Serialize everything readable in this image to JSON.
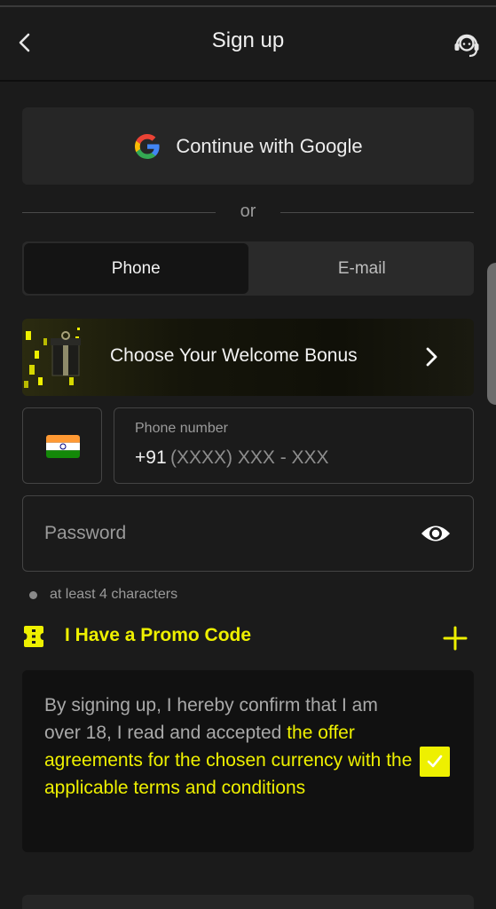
{
  "header": {
    "title": "Sign up",
    "back_icon": "chevron-left-icon",
    "support_icon": "headset-support-icon"
  },
  "google": {
    "label": "Continue with Google",
    "icon": "google-logo-icon"
  },
  "divider": {
    "text": "or"
  },
  "tabs": [
    {
      "label": "Phone",
      "active": true
    },
    {
      "label": "E-mail",
      "active": false
    }
  ],
  "bonus": {
    "label": "Choose Your Welcome Bonus",
    "icon": "chevron-right-icon"
  },
  "phone": {
    "country_flag": "india-flag-icon",
    "label": "Phone number",
    "prefix": "+91",
    "placeholder": "(XXXX) XXX - XXX"
  },
  "password": {
    "placeholder": "Password",
    "icon": "eye-icon"
  },
  "hint": {
    "text": "at least 4 characters"
  },
  "promo": {
    "label": "I Have a Promo Code",
    "icon": "ticket-icon",
    "add_icon": "plus-icon"
  },
  "terms": {
    "text_before": "By signing up, I hereby confirm that I am over 18, I read and accepted ",
    "link_text": "the offer agreements for the chosen currency with the applicable terms and conditions",
    "checked": true
  },
  "colors": {
    "accent": "#eef000",
    "background": "#1b1b1b",
    "card": "#262626"
  }
}
